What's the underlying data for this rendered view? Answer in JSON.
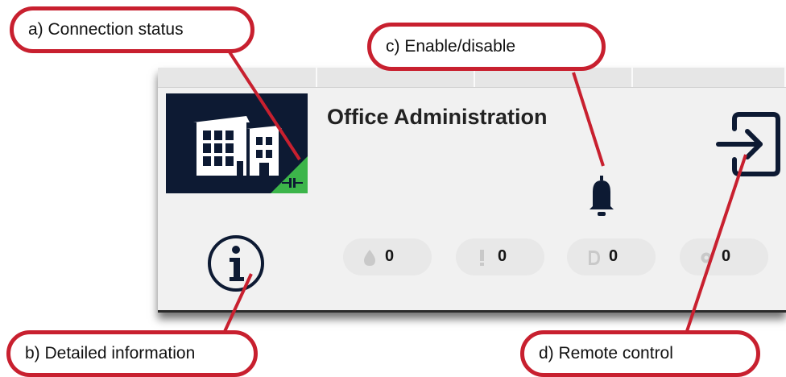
{
  "card": {
    "title": "Office Administration",
    "connection_color": "#3cb54a",
    "counters": [
      {
        "icon": "droplet-icon",
        "value": "0"
      },
      {
        "icon": "exclamation-icon",
        "value": "0"
      },
      {
        "icon": "d-icon",
        "value": "0"
      },
      {
        "icon": "gear-icon",
        "value": "0"
      }
    ]
  },
  "callouts": {
    "a": "a) Connection status",
    "b": "b) Detailed information",
    "c": "c) Enable/disable",
    "d": "d) Remote control"
  },
  "colors": {
    "callout_border": "#c8202f",
    "icon_background": "#0d1a33"
  }
}
